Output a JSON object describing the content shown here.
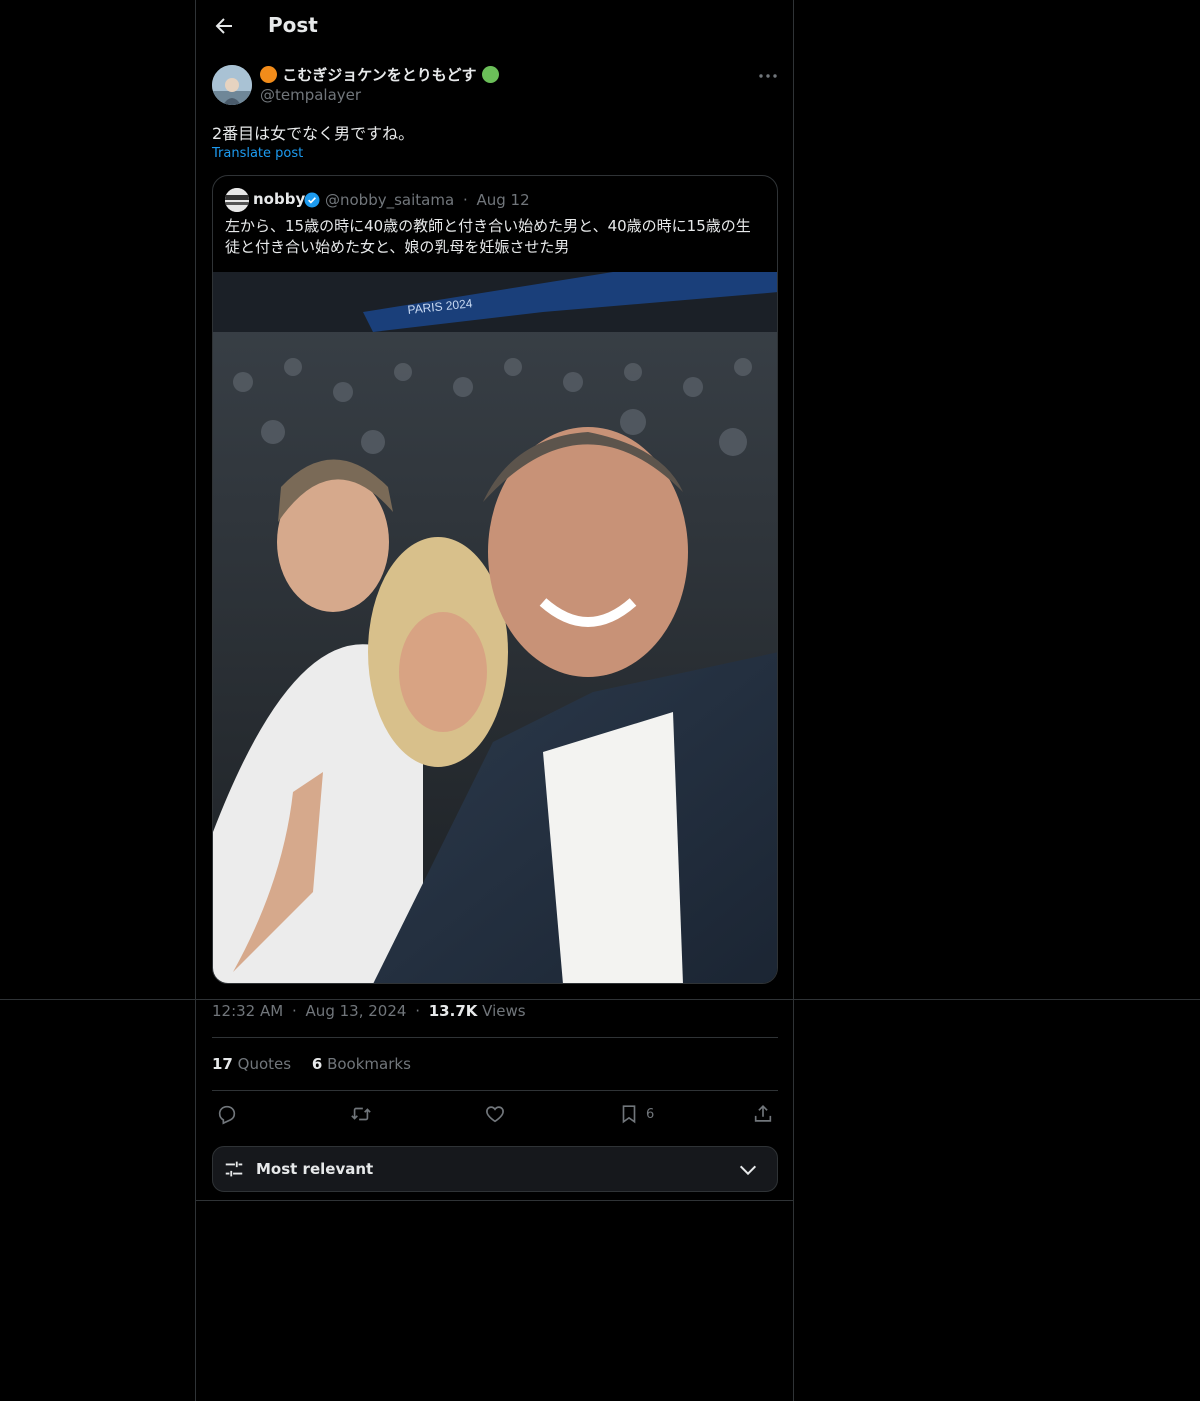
{
  "header": {
    "title": "Post"
  },
  "post": {
    "display_name": "こむぎジョケンをとりもどす",
    "name_prefix_dot_color": "#f28c1a",
    "name_suffix_dot_color": "#6bbf59",
    "handle": "@tempalayer",
    "text": "2番目は女でなく男ですね。",
    "translate_label": "Translate post"
  },
  "quote": {
    "name": "nobby",
    "handle": "@nobby_saitama",
    "sep": "·",
    "date": "Aug 12",
    "text": "左から、15歳の時に40歳の教師と付き合い始めた男と、40歳の時に15歳の生徒と付き合い始めた女と、娘の乳母を妊娠させた男",
    "photo_banner": "PARIS 2024"
  },
  "meta": {
    "time": "12:32 AM",
    "sep": "·",
    "date": "Aug 13, 2024",
    "views_count": "13.7K",
    "views_label": "Views"
  },
  "stats": {
    "quotes_count": "17",
    "quotes_label": "Quotes",
    "bookmarks_count": "6",
    "bookmarks_label": "Bookmarks"
  },
  "actions": {
    "bookmark_count": "6"
  },
  "sort": {
    "label": "Most relevant"
  },
  "colors": {
    "accent": "#1d9bf0",
    "border": "#2f3336",
    "muted": "#71767b"
  }
}
